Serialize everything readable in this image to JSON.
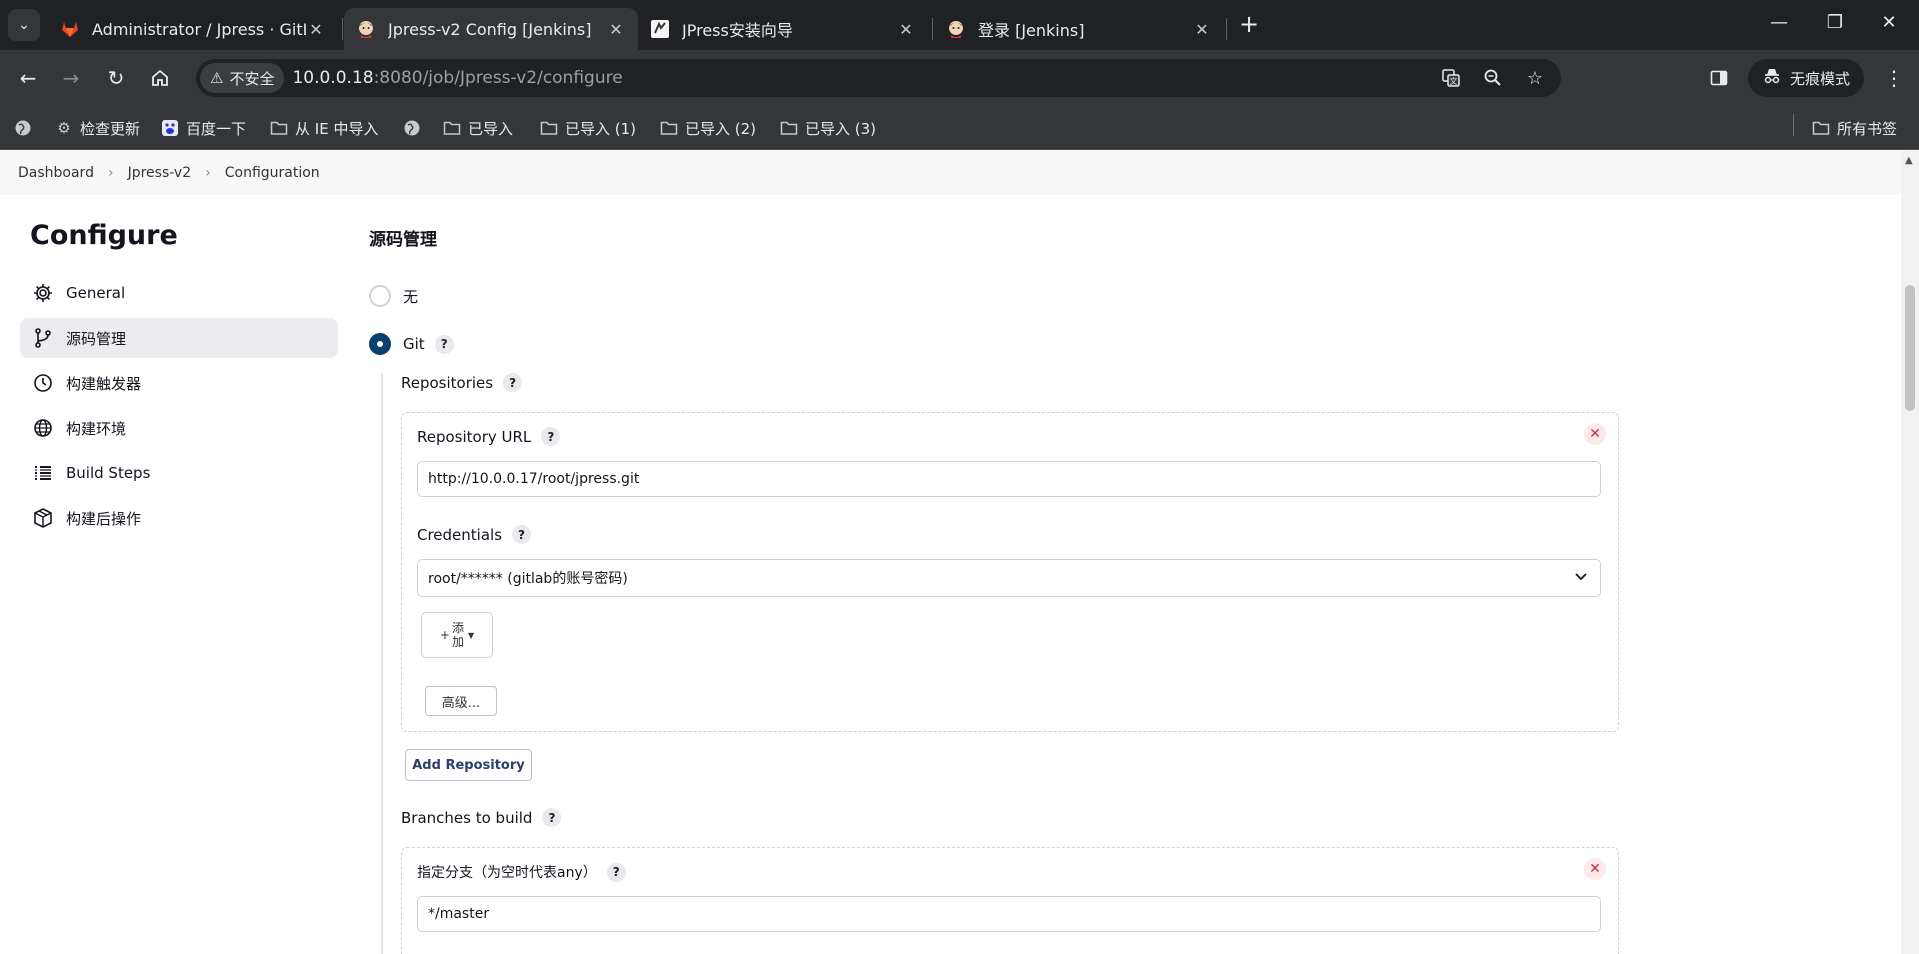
{
  "browser": {
    "tabs": [
      {
        "title": "Administrator / Jpress · GitLab",
        "icon": "gitlab-icon",
        "active": false
      },
      {
        "title": "Jpress-v2 Config [Jenkins]",
        "icon": "jenkins-icon",
        "active": true
      },
      {
        "title": "JPress安装向导",
        "icon": "jpress-icon",
        "active": false
      },
      {
        "title": "登录 [Jenkins]",
        "icon": "jenkins-icon",
        "active": false
      }
    ],
    "close_glyph": "✕",
    "new_tab_glyph": "+",
    "security_label": "不安全",
    "url_host": "10.0.0.18",
    "url_rest": ":8080/job/Jpress-v2/configure",
    "incognito_label": "无痕模式",
    "bookmarks": [
      {
        "label": "",
        "icon": "globe-icon"
      },
      {
        "label": "检查更新",
        "icon": "gear-icon"
      },
      {
        "label": "百度一下",
        "icon": "baidu-icon"
      },
      {
        "label": "从 IE 中导入",
        "icon": "folder-icon"
      },
      {
        "label": "",
        "icon": "globe-icon"
      },
      {
        "label": "已导入",
        "icon": "folder-icon"
      },
      {
        "label": "已导入 (1)",
        "icon": "folder-icon"
      },
      {
        "label": "已导入 (2)",
        "icon": "folder-icon"
      },
      {
        "label": "已导入 (3)",
        "icon": "folder-icon"
      }
    ],
    "all_bookmarks_label": "所有书签"
  },
  "breadcrumbs": [
    "Dashboard",
    "Jpress-v2",
    "Configuration"
  ],
  "sidebar": {
    "title": "Configure",
    "items": [
      {
        "label": "General",
        "icon": "gear-icon",
        "active": false
      },
      {
        "label": "源码管理",
        "icon": "branch-icon",
        "active": true
      },
      {
        "label": "构建触发器",
        "icon": "clock-icon",
        "active": false
      },
      {
        "label": "构建环境",
        "icon": "globe-icon",
        "active": false
      },
      {
        "label": "Build Steps",
        "icon": "list-icon",
        "active": false
      },
      {
        "label": "构建后操作",
        "icon": "package-icon",
        "active": false
      }
    ]
  },
  "scm": {
    "section_title": "源码管理",
    "option_none": "无",
    "option_git": "Git",
    "selected": "Git",
    "help_glyph": "?",
    "repositories_label": "Repositories",
    "repository_url_label": "Repository URL",
    "repository_url_value": "http://10.0.0.17/root/jpress.git",
    "credentials_label": "Credentials",
    "credentials_value": "root/****** (gitlab的账号密码)",
    "add_label_line1": "添",
    "add_label_line2": "加",
    "advanced_label": "高级...",
    "add_repository_label": "Add Repository",
    "branches_label": "Branches to build",
    "branch_specifier_label": "指定分支（为空时代表any）",
    "branch_specifier_value": "*/master"
  }
}
